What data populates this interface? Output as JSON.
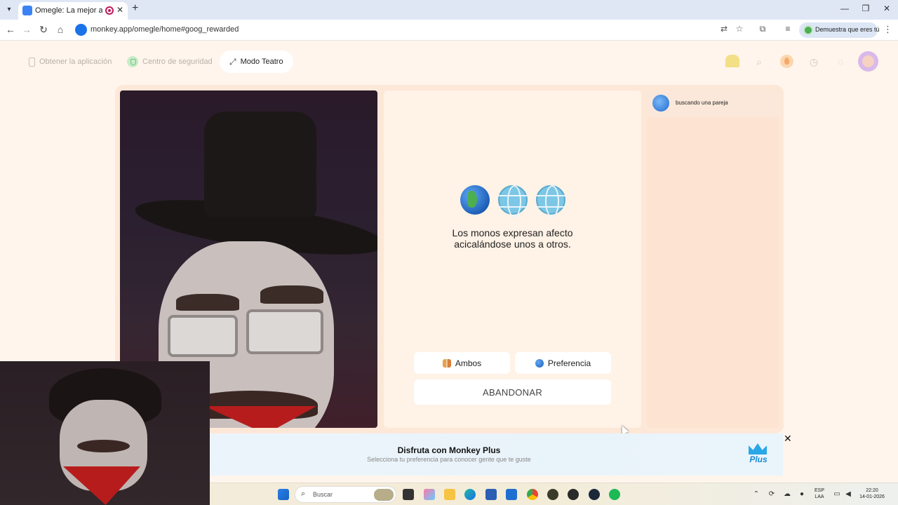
{
  "browser": {
    "tab_title": "Omegle: La mejor alternativ",
    "tab_close": "✕",
    "new_tab": "+",
    "url": "monkey.app/omegle/home#goog_rewarded",
    "profile_label": "Demuestra que eres tú",
    "window_minimize": "—",
    "window_restore": "❐",
    "window_close": "✕"
  },
  "nav": {
    "get_app": "Obtener la aplicación",
    "safety_center": "Centro de seguridad",
    "theater_mode": "Modo Teatro"
  },
  "main": {
    "fact_text": "Los monos expresan afecto acicalándose unos a otros.",
    "both_label": "Ambos",
    "preference_label": "Preferencia",
    "abandon_label": "ABANDONAR"
  },
  "chat": {
    "status_text": "buscando una pareja"
  },
  "promo": {
    "title": "Disfruta con Monkey Plus",
    "subtitle": "Selecciona tu preferencia para conocer gente que te guste",
    "badge_text": "Plus",
    "close": "✕"
  },
  "taskbar": {
    "search_placeholder": "Buscar",
    "language_line1": "ESP",
    "language_line2": "LAA",
    "time": "22:20",
    "date": "14-01-2026"
  },
  "colors": {
    "page_background": "#fff5ec",
    "stage_background": "#fde8d8",
    "accent_blue": "#1a8ad4"
  }
}
